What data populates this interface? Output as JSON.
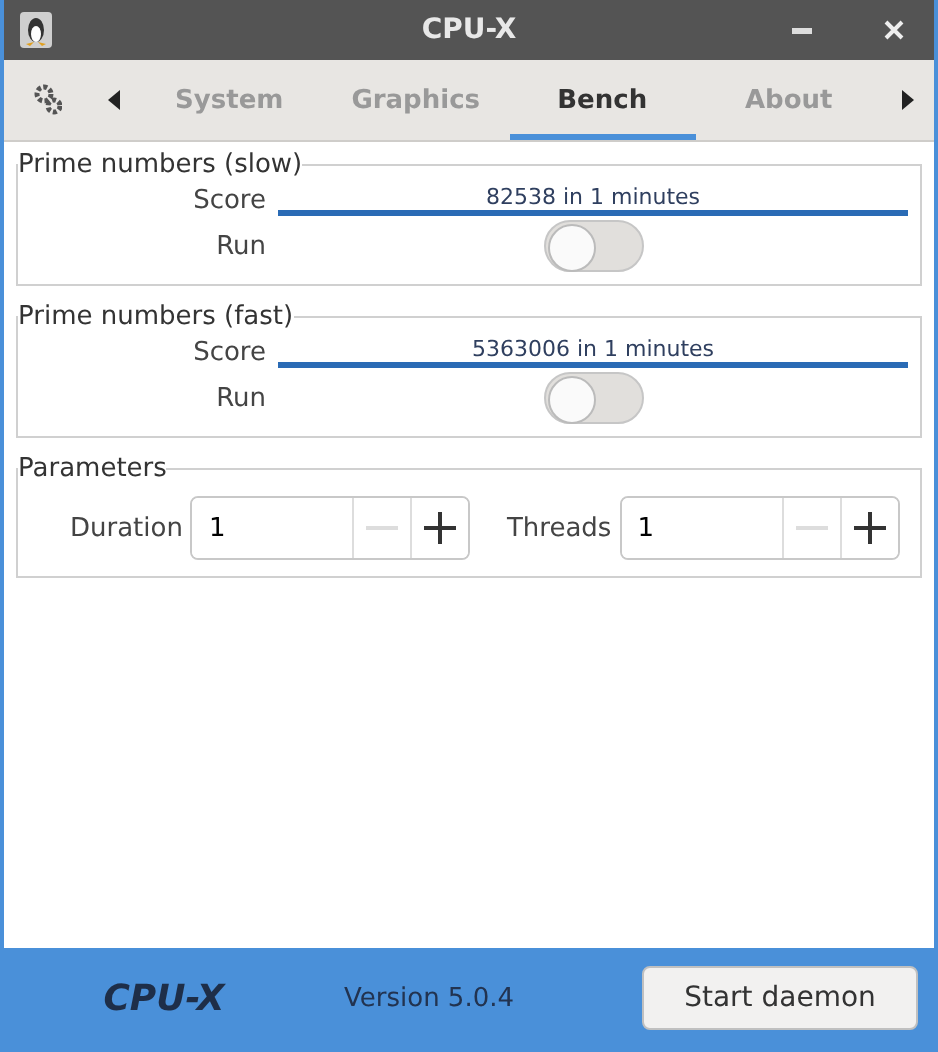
{
  "window": {
    "title": "CPU-X"
  },
  "tabs": [
    {
      "label": "System",
      "selected": false
    },
    {
      "label": "Graphics",
      "selected": false
    },
    {
      "label": "Bench",
      "selected": true
    },
    {
      "label": "About",
      "selected": false
    }
  ],
  "sections": [
    {
      "title": "Prime numbers (slow)",
      "score_label": "Score",
      "score": "82538 in 1 minutes",
      "level": 1,
      "run_label": "Run",
      "on": false
    },
    {
      "title": "Prime numbers (fast)",
      "score_label": "Score",
      "score": "5363006 in 1 minutes",
      "level": 1,
      "run_label": "Run",
      "on": false
    }
  ],
  "parameters": {
    "title": "Parameters",
    "fields": [
      {
        "label": "Duration",
        "value": "1",
        "minus_disabled": true
      },
      {
        "label": "Threads",
        "value": "1",
        "minus_disabled": true
      }
    ]
  },
  "footer": {
    "logo": "CPU-X",
    "version": "Version 5.0.4",
    "button": "Start daemon"
  }
}
